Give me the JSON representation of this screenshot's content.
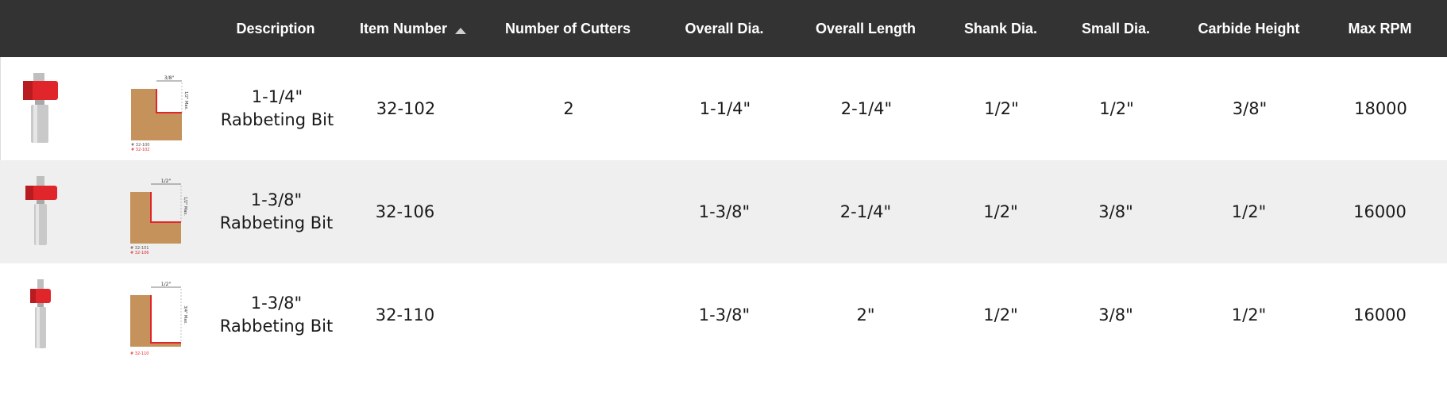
{
  "table": {
    "headers": {
      "description": "Description",
      "item_number": "Item Number",
      "cutters": "Number of Cutters",
      "overall_dia": "Overall Dia.",
      "overall_length": "Overall Length",
      "shank_dia": "Shank Dia.",
      "small_dia": "Small Dia.",
      "carbide_height": "Carbide Height",
      "max_rpm": "Max RPM"
    },
    "sort": {
      "column": "Item Number",
      "direction": "ascending",
      "icon": "sort-ascending-icon"
    },
    "rows": [
      {
        "description": "1-1/4\" Rabbeting Bit",
        "item_number": "32-102",
        "cutters": "2",
        "overall_dia": "1-1/4\"",
        "overall_length": "2-1/4\"",
        "shank_dia": "1/2\"",
        "small_dia": "1/2\"",
        "carbide_height": "3/8\"",
        "max_rpm": "18000",
        "diagram": {
          "top": "3/8\"",
          "side": "1/2\" Max.",
          "refs": [
            "# 32-100",
            "# 32-102"
          ]
        }
      },
      {
        "description": "1-3/8\" Rabbeting Bit",
        "item_number": "32-106",
        "cutters": "",
        "overall_dia": "1-3/8\"",
        "overall_length": "2-1/4\"",
        "shank_dia": "1/2\"",
        "small_dia": "3/8\"",
        "carbide_height": "1/2\"",
        "max_rpm": "16000",
        "diagram": {
          "top": "1/2\"",
          "side": "1/2\" Max.",
          "refs": [
            "# 32-101",
            "# 32-106"
          ]
        }
      },
      {
        "description": "1-3/8\" Rabbeting Bit",
        "item_number": "32-110",
        "cutters": "",
        "overall_dia": "1-3/8\"",
        "overall_length": "2\"",
        "shank_dia": "1/2\"",
        "small_dia": "3/8\"",
        "carbide_height": "1/2\"",
        "max_rpm": "16000",
        "diagram": {
          "top": "1/2\"",
          "side": "3/4\" Max.",
          "refs": [
            "# 32-110"
          ]
        }
      }
    ]
  },
  "colors": {
    "header_bg": "#333333",
    "header_text": "#ffffff",
    "alt_row_bg": "#efefef",
    "bit_red": "#e0262b",
    "wood": "#c4925a",
    "ref_red": "#e0262b"
  }
}
